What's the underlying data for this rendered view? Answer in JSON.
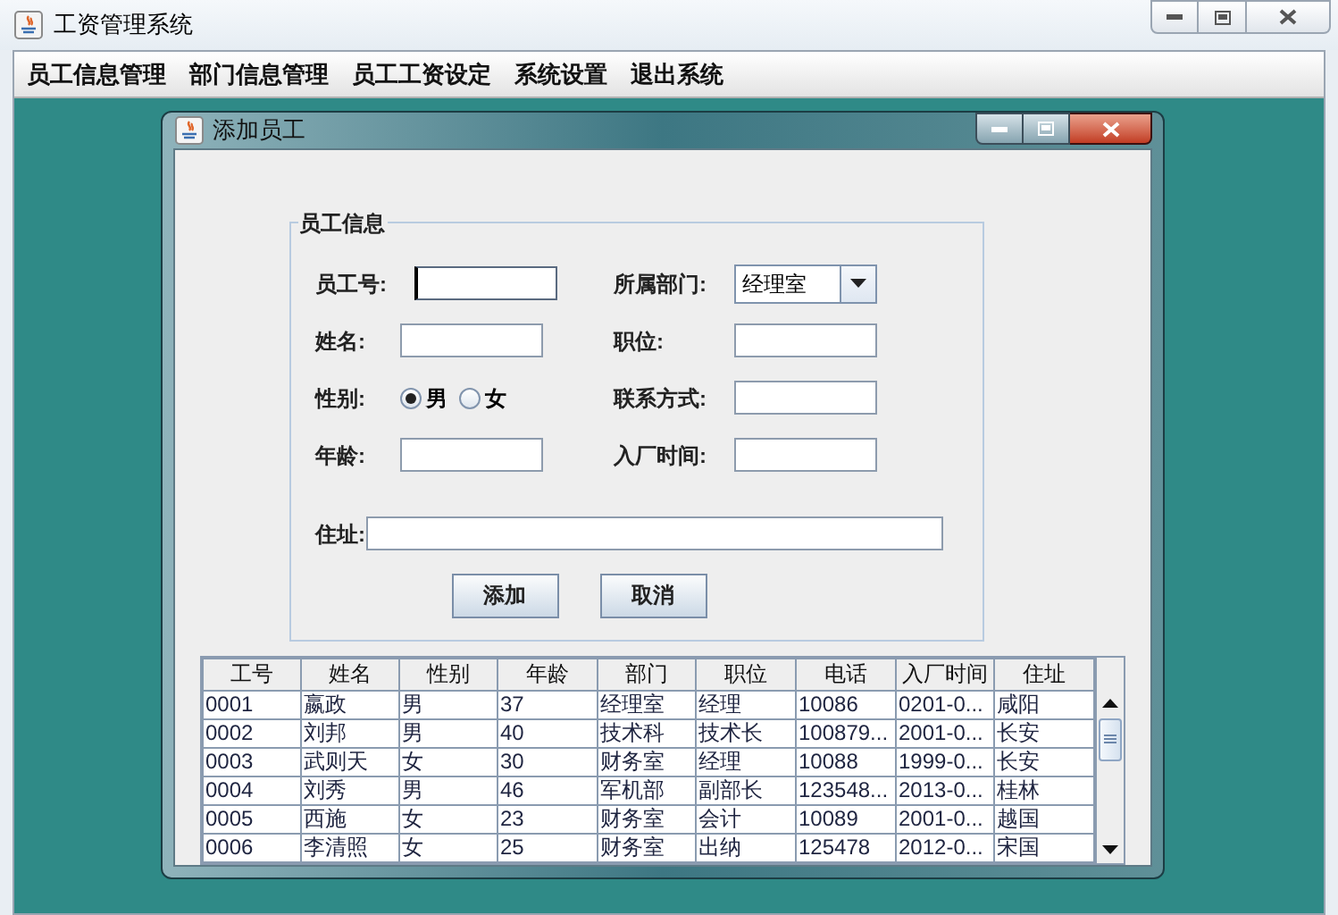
{
  "window": {
    "title": "工资管理系统"
  },
  "menu": [
    "员工信息管理",
    "部门信息管理",
    "员工工资设定",
    "系统设置",
    "退出系统"
  ],
  "dialog": {
    "title": "添加员工",
    "group_title": "员工信息",
    "fields": [
      {
        "kind": "text",
        "label": "员工号:",
        "focused": true
      },
      {
        "kind": "combo",
        "label": "所属部门:",
        "value": "经理室"
      },
      {
        "kind": "text",
        "label": "姓名:",
        "focused": false
      },
      {
        "kind": "text",
        "label": "职位:",
        "focused": false
      },
      {
        "kind": "radio",
        "label": "性别:",
        "options": [
          {
            "label": "男",
            "selected": true
          },
          {
            "label": "女",
            "selected": false
          }
        ]
      },
      {
        "kind": "text",
        "label": "联系方式:",
        "focused": false
      },
      {
        "kind": "text",
        "label": "年龄:",
        "focused": false
      },
      {
        "kind": "text",
        "label": "入厂时间:",
        "focused": false
      },
      {
        "kind": "wide",
        "label": "住址:",
        "focused": false
      }
    ],
    "buttons": [
      "添加",
      "取消"
    ],
    "table": {
      "columns": [
        "工号",
        "姓名",
        "性别",
        "年龄",
        "部门",
        "职位",
        "电话",
        "入厂时间",
        "住址"
      ],
      "rows": [
        [
          "0001",
          "嬴政",
          "男",
          "37",
          "经理室",
          "经理",
          "10086",
          "0201-0...",
          "咸阳"
        ],
        [
          "0002",
          "刘邦",
          "男",
          "40",
          "技术科",
          "技术长",
          "100879...",
          "2001-0...",
          "长安"
        ],
        [
          "0003",
          "武则天",
          "女",
          "30",
          "财务室",
          "经理",
          "10088",
          "1999-0...",
          "长安"
        ],
        [
          "0004",
          "刘秀",
          "男",
          "46",
          "军机部",
          "副部长",
          "123548...",
          "2013-0...",
          "桂林"
        ],
        [
          "0005",
          "西施",
          "女",
          "23",
          "财务室",
          "会计",
          "10089",
          "2001-0...",
          "越国"
        ],
        [
          "0006",
          "李清照",
          "女",
          "25",
          "财务室",
          "出纳",
          "125478",
          "2012-0...",
          "宋国"
        ]
      ]
    }
  }
}
